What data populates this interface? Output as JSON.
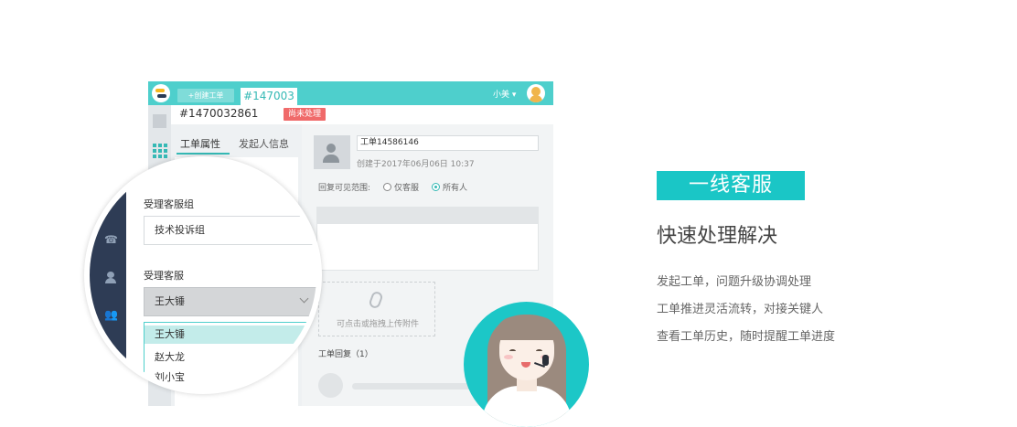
{
  "app": {
    "create_button": "+创建工单",
    "active_tab": "#147003",
    "user_name": "小美 ▾",
    "ticket_id": "#1470032861",
    "status_badge": "尚未处理",
    "tabs": {
      "properties": "工单属性",
      "sender_info": "发起人信息"
    },
    "detail": {
      "title_value": "工单14586146",
      "created_at": "创建于2017年06月06日 10:37",
      "visibility_label": "回复可见范围:",
      "visibility_options": [
        "仅客服",
        "所有人"
      ],
      "visibility_selected": "所有人",
      "upload_hint": "可点击或拖拽上传附件",
      "reply_count": "工单回复（1）"
    }
  },
  "magnifier": {
    "group_label": "受理客服组",
    "group_value": "技术投诉组",
    "agent_label": "受理客服",
    "agent_value": "王大锤",
    "options": [
      "王大锤",
      "赵大龙",
      "刘小宝"
    ]
  },
  "hero": {
    "badge": "一线客服",
    "heading": "快速处理解决",
    "features": [
      "发起工单，问题升级协调处理",
      "工单推进灵活流转，对接关键人",
      "查看工单历史，随时提醒工单进度"
    ]
  },
  "colors": {
    "accent": "#4ecfcc",
    "badge": "#1ac6c6",
    "status": "#f06a6a",
    "nav_dark": "#2e3c55"
  },
  "icons": [
    "logo-icon",
    "avatar-icon",
    "grid-icon",
    "phone-icon",
    "person-icon",
    "group-icon",
    "paperclip-icon",
    "chevron-down-icon"
  ]
}
